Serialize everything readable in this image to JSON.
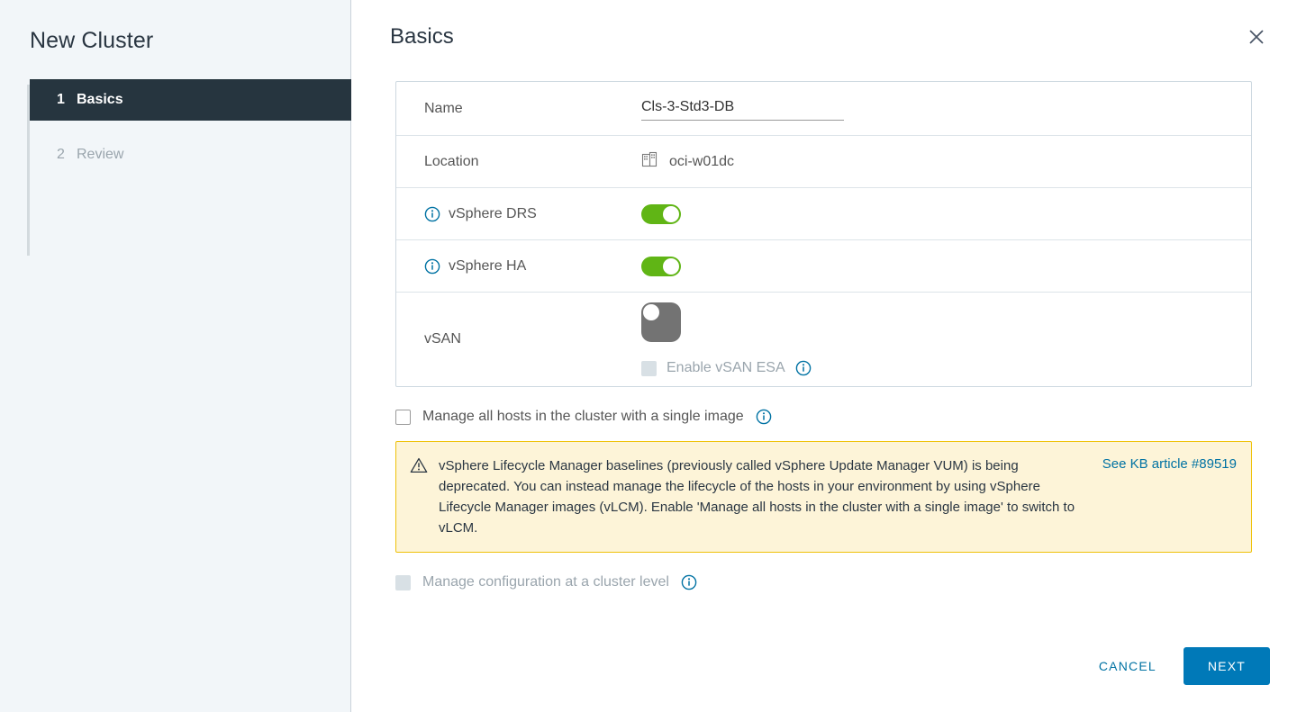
{
  "sidebar": {
    "title": "New Cluster",
    "steps": [
      {
        "num": "1",
        "label": "Basics",
        "state": "active"
      },
      {
        "num": "2",
        "label": "Review",
        "state": "inactive"
      }
    ]
  },
  "header": {
    "title": "Basics",
    "close_label": "×"
  },
  "form": {
    "name": {
      "label": "Name",
      "value": "Cls-3-Std3-DB",
      "placeholder": ""
    },
    "location": {
      "label": "Location",
      "value": "oci-w01dc",
      "icon": "datacenter-icon"
    },
    "drs": {
      "label": "vSphere DRS",
      "info_icon": "info-icon",
      "state": "on"
    },
    "ha": {
      "label": "vSphere HA",
      "info_icon": "info-icon",
      "state": "on"
    },
    "vsan": {
      "label": "vSAN",
      "state": "off",
      "esa_label": "Enable vSAN ESA",
      "esa_checked": false,
      "esa_disabled": true,
      "esa_info_icon": "info-icon"
    }
  },
  "options": {
    "single_image": {
      "label": "Manage all hosts in the cluster with a single image",
      "checked": false,
      "disabled": false,
      "info_icon": "info-icon"
    },
    "cluster_config": {
      "label": "Manage configuration at a cluster level",
      "checked": false,
      "disabled": true,
      "info_icon": "info-icon"
    }
  },
  "warning": {
    "icon": "warning-triangle-icon",
    "text": "vSphere Lifecycle Manager baselines (previously called vSphere Update Manager VUM) is being deprecated. You can instead manage the lifecycle of the hosts in your environment by using vSphere Lifecycle Manager images (vLCM). Enable 'Manage all hosts in the cluster with a single image' to switch to vLCM.",
    "link_text": "See KB article #89519"
  },
  "footer": {
    "cancel_label": "CANCEL",
    "next_label": "NEXT"
  },
  "colors": {
    "accent_blue": "#0079b8",
    "link_blue": "#0072a3",
    "toggle_on_green": "#60b515",
    "toggle_off_gray": "#737373",
    "step_active_bg": "#26353f",
    "sidebar_bg": "#f2f6f9",
    "warning_bg": "#fdf4d8",
    "warning_border": "#efc20a"
  }
}
